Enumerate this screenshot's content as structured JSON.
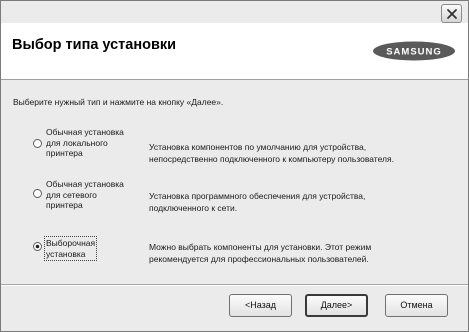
{
  "header": {
    "title": "Выбор типа установки",
    "logo_text": "SAMSUNG"
  },
  "instruction": "Выберите нужный тип и нажмите на кнопку «Далее».",
  "options": [
    {
      "label": "Обычная установка\nдля локального\nпринтера",
      "description": "Установка компонентов по умолчанию для устройства,\nнепосредственно подключенного к компьютеру пользователя.",
      "selected": false
    },
    {
      "label": "Обычная установка\nдля сетевого\nпринтера",
      "description": "Установка программного обеспечения для устройства,\nподключенного к сети.",
      "selected": false
    },
    {
      "label": "Выборочная\nустановка",
      "description": "Можно выбрать компоненты для установки. Этот режим\nрекомендуется для профессиональных пользователей.",
      "selected": true
    }
  ],
  "buttons": {
    "back": "<Назад",
    "next": "Далее>",
    "cancel": "Отмена"
  },
  "colors": {
    "header_bg": "#ffffff",
    "body_bg": "#ebebeb",
    "logo": "#5a5a5a"
  },
  "icons": {
    "close": "close-icon",
    "radio": "radio-icon"
  }
}
